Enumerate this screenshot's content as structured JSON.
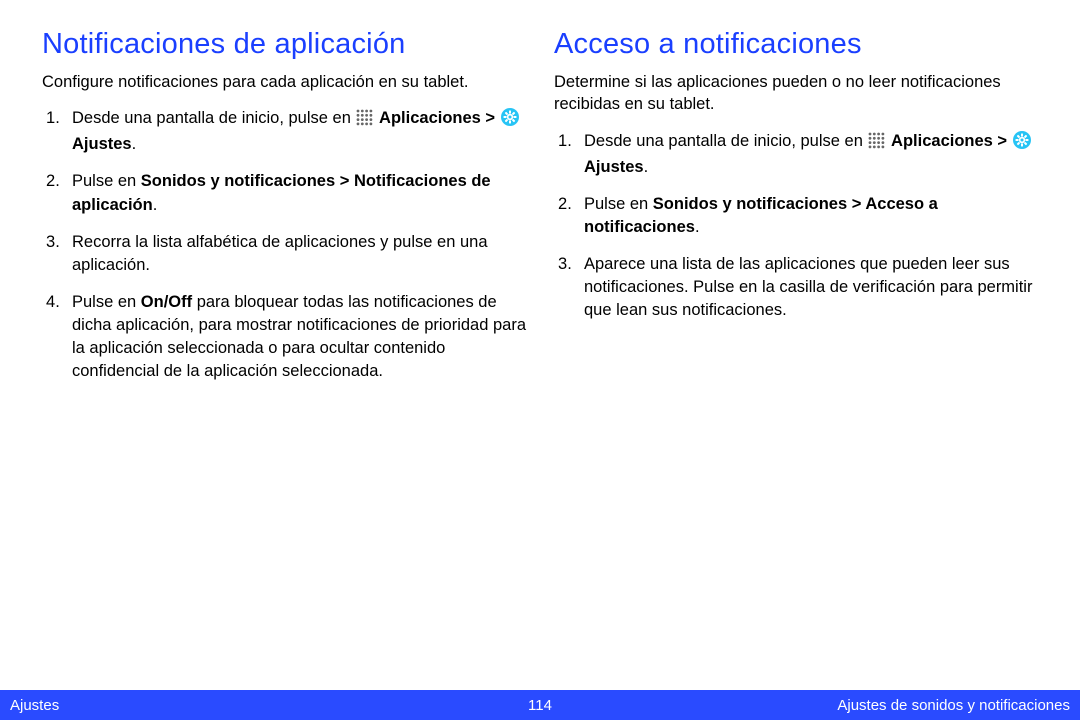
{
  "left": {
    "heading": "Notificaciones de aplicación",
    "intro": "Configure notificaciones para cada aplicación en su tablet.",
    "steps": {
      "s1_a": "Desde una pantalla de inicio, pulse en ",
      "s1_apps": "Aplicaciones",
      "s1_gt": " > ",
      "s1_settings": "Ajustes",
      "s2_a": "Pulse en ",
      "s2_b": "Sonidos y notificaciones > Notificaciones de aplicación",
      "s3": "Recorra la lista alfabética de aplicaciones y pulse en una aplicación.",
      "s4_a": "Pulse en ",
      "s4_b": "On/Off",
      "s4_c": " para bloquear todas las notificaciones de dicha aplicación, para mostrar notificaciones de prioridad para la aplicación seleccionada o para ocultar contenido confidencial de la aplicación seleccionada."
    }
  },
  "right": {
    "heading": "Acceso a notificaciones",
    "intro": "Determine si las aplicaciones pueden o no leer notificaciones recibidas en su tablet.",
    "steps": {
      "s1_a": "Desde una pantalla de inicio, pulse en ",
      "s1_apps": "Aplicaciones",
      "s1_gt": " > ",
      "s1_settings": "Ajustes",
      "s2_a": "Pulse en ",
      "s2_b": "Sonidos y notificaciones > Acceso a notificaciones",
      "s3": "Aparece una lista de las aplicaciones que pueden leer sus notificaciones. Pulse en la casilla de verificación para permitir que lean sus notificaciones."
    }
  },
  "footer": {
    "left": "Ajustes",
    "page": "114",
    "right": "Ajustes de sonidos y notificaciones"
  },
  "period": "."
}
